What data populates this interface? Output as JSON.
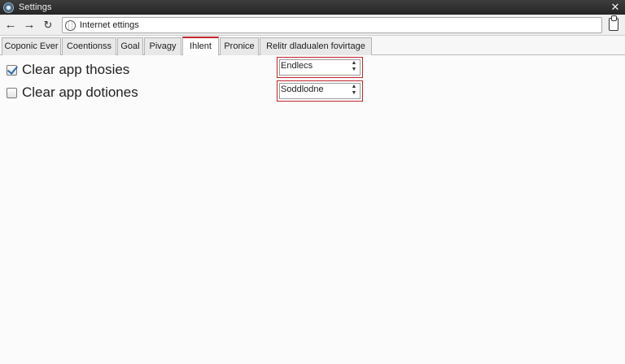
{
  "window": {
    "title": "Settings",
    "close_glyph": "✕",
    "app_icon": "app-icon"
  },
  "nav": {
    "back_glyph": "←",
    "forward_glyph": "→",
    "reload_glyph": "↻",
    "address_text": "Internet ettings",
    "address_icon": "globe-icon",
    "right_icon": "clipboard-icon"
  },
  "tabs": [
    {
      "label": "Coponic Ever",
      "active": false
    },
    {
      "label": "Coentionss",
      "active": false
    },
    {
      "label": "Goal",
      "active": false
    },
    {
      "label": "Pivagy",
      "active": false
    },
    {
      "label": "Ihlent",
      "active": true
    },
    {
      "label": "Pronice",
      "active": false
    },
    {
      "label": "Relitr dladualen fovirtage",
      "active": false
    }
  ],
  "options": [
    {
      "label": "Clear app thosies",
      "checked": true,
      "select_value": "Endlecs"
    },
    {
      "label": "Clear app dotiones",
      "checked": false,
      "select_value": "Soddlodne"
    }
  ],
  "colors": {
    "accent": "#c0262b",
    "check": "#2d6ab5"
  }
}
